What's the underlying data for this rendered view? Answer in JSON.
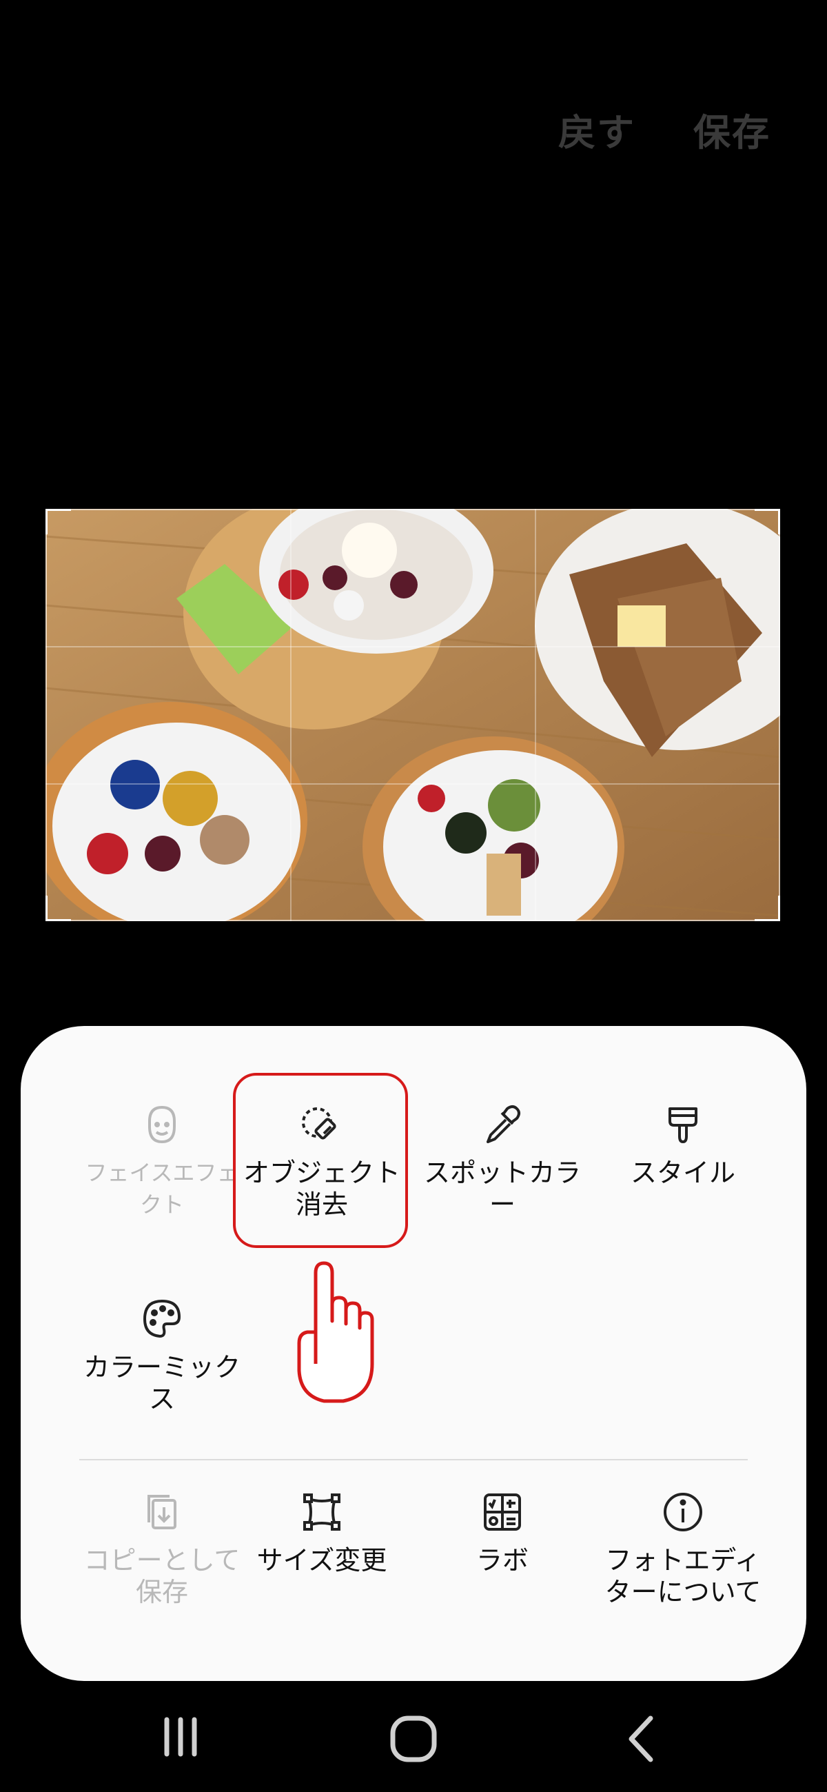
{
  "top_actions": {
    "revert": "戻す",
    "save": "保存"
  },
  "tools": [
    {
      "label": "フェイスエフェクト",
      "icon": "face-icon",
      "enabled": false
    },
    {
      "label": "オブジェクト消去",
      "icon": "object-eraser-icon",
      "enabled": true,
      "highlighted": true
    },
    {
      "label": "スポットカラー",
      "icon": "eyedropper-icon",
      "enabled": true
    },
    {
      "label": "スタイル",
      "icon": "paint-brush-icon",
      "enabled": true
    },
    {
      "label": "カラーミックス",
      "icon": "palette-icon",
      "enabled": true
    }
  ],
  "actions": [
    {
      "label": "コピーとして保存",
      "icon": "copy-save-icon",
      "enabled": false
    },
    {
      "label": "サイズ変更",
      "icon": "resize-icon",
      "enabled": true
    },
    {
      "label": "ラボ",
      "icon": "labs-icon",
      "enabled": true
    },
    {
      "label": "フォトエディターについて",
      "icon": "info-icon",
      "enabled": true
    }
  ],
  "navigation": [
    "recent-apps-icon",
    "home-icon",
    "back-icon"
  ],
  "colors": {
    "highlight": "#d61a1a",
    "disabled": "#b8b8b8",
    "panel": "#fafafa"
  }
}
